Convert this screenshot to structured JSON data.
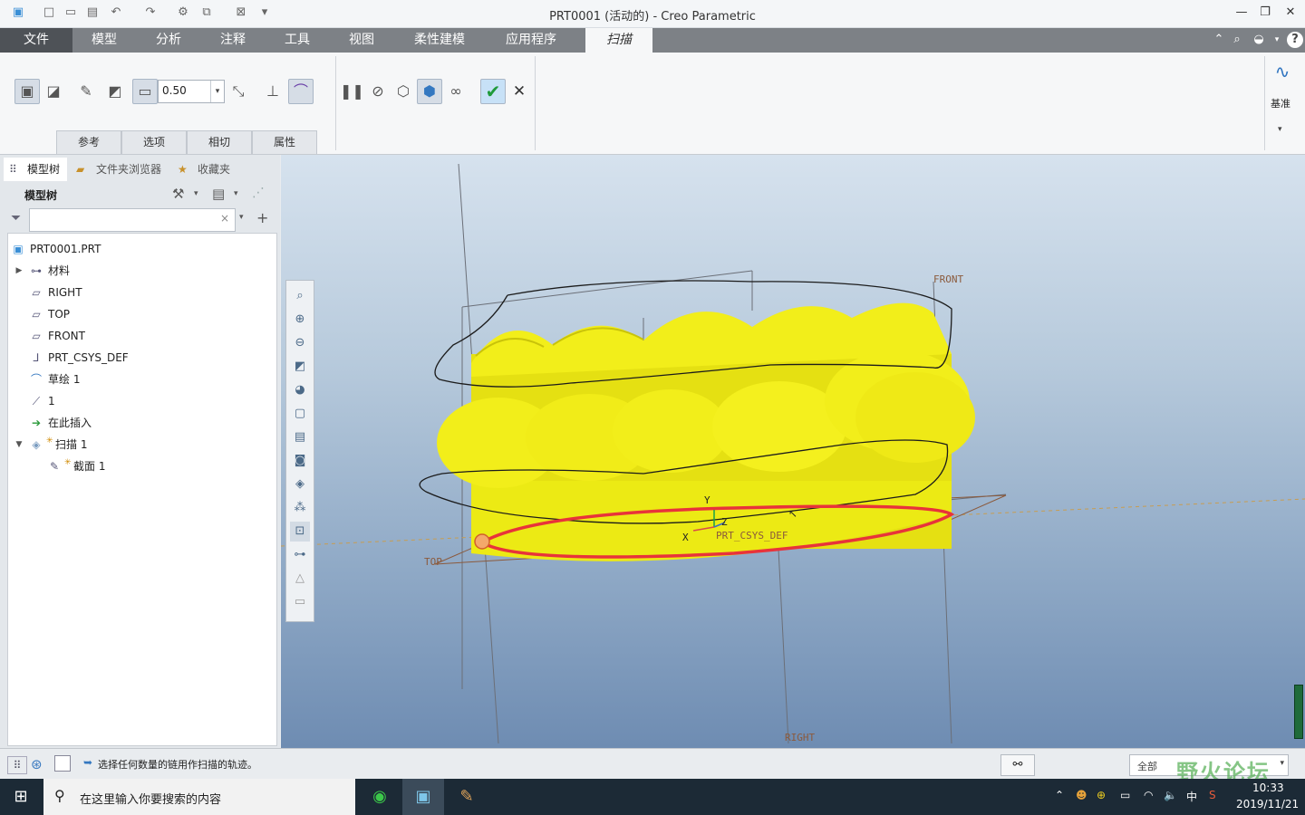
{
  "window": {
    "title": "PRT0001 (活动的) - Creo Parametric",
    "controls": {
      "minimize": "—",
      "restore": "❐",
      "close": "✕"
    }
  },
  "menu": {
    "tabs": [
      "文件",
      "模型",
      "分析",
      "注释",
      "工具",
      "视图",
      "柔性建模",
      "应用程序",
      "扫描"
    ],
    "active": "扫描"
  },
  "ribbon": {
    "thickness_value": "0.50",
    "subtabs": [
      "参考",
      "选项",
      "相切",
      "属性"
    ],
    "datum_label": "基准"
  },
  "left_panel": {
    "tabs": [
      "模型树",
      "文件夹浏览器",
      "收藏夹"
    ],
    "tree_title": "模型树",
    "search_value": "",
    "tree": [
      {
        "label": "PRT0001.PRT",
        "icon": "part-icon"
      },
      {
        "label": "材料",
        "icon": "material-icon"
      },
      {
        "label": "RIGHT",
        "icon": "datum-plane-icon"
      },
      {
        "label": "TOP",
        "icon": "datum-plane-icon"
      },
      {
        "label": "FRONT",
        "icon": "datum-plane-icon"
      },
      {
        "label": "PRT_CSYS_DEF",
        "icon": "csys-icon"
      },
      {
        "label": "草绘 1",
        "icon": "sketch-icon"
      },
      {
        "label": "1",
        "icon": "graph-icon"
      },
      {
        "label": "在此插入",
        "icon": "insert-arrow-icon"
      },
      {
        "label": "扫描 1",
        "icon": "sweep-icon"
      },
      {
        "label": "截面 1",
        "icon": "section-icon"
      }
    ]
  },
  "viewport": {
    "labels": {
      "front": "FRONT",
      "top": "TOP",
      "right": "RIGHT",
      "csys": "PRT_CSYS_DEF",
      "x": "X",
      "y": "Y",
      "z": "Z"
    },
    "colors": {
      "model": "#f2ee1a",
      "trajectory": "#e8333a",
      "background_top": "#d6e2ee",
      "background_bottom": "#6e8cb2"
    }
  },
  "status": {
    "message": "选择任何数量的链用作扫描的轨迹。",
    "filter_value": "全部",
    "watermark": "野火论坛"
  },
  "taskbar": {
    "search_placeholder": "在这里输入你要搜索的内容",
    "ime": "中",
    "time": "10:33",
    "date": "2019/11/21"
  }
}
